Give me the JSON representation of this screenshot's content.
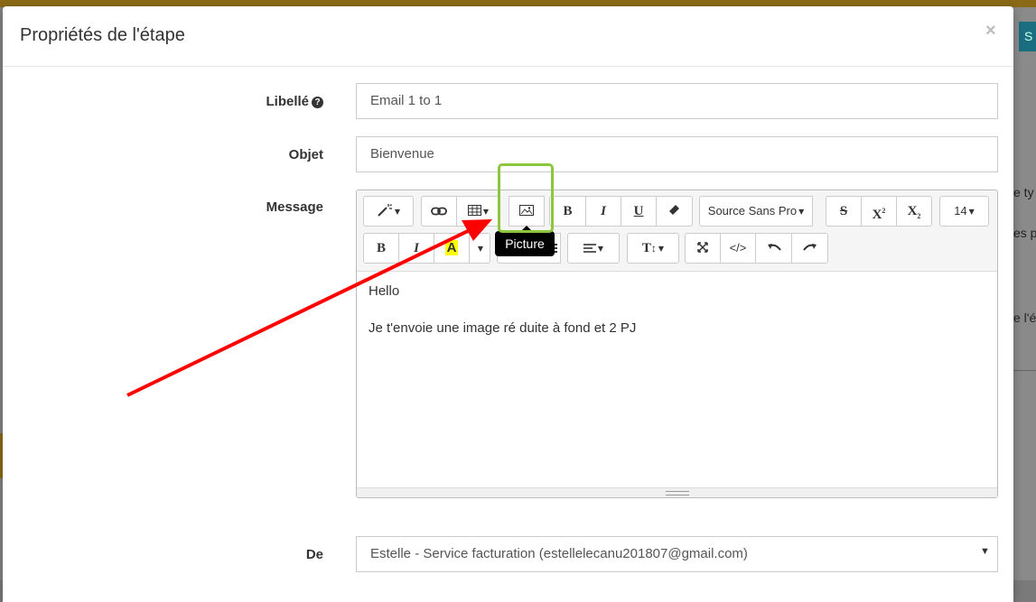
{
  "background": {
    "right_button_label": "S",
    "side_texts": [
      "e ty",
      "es pr",
      "e l'é"
    ]
  },
  "modal": {
    "title": "Propriétés de l'étape",
    "close_label": "×"
  },
  "form": {
    "libelle_label": "Libellé",
    "libelle_value": "Email 1 to 1",
    "objet_label": "Objet",
    "objet_value": "Bienvenue",
    "message_label": "Message",
    "de_label": "De",
    "de_value": "Estelle - Service facturation (estellelecanu201807@gmail.com)"
  },
  "toolbar": {
    "font_name": "Source Sans Pro",
    "font_size": "14",
    "bold": "B",
    "italic": "I",
    "underline": "U",
    "strike": "S",
    "superscript": "X",
    "subscript": "X",
    "highlight": "A",
    "line_height": "T",
    "code": "</>"
  },
  "tooltip": {
    "text": "Picture"
  },
  "editor": {
    "lines": [
      "Hello",
      "Je t'envoie une image ré duite à fond et 2 PJ"
    ]
  },
  "colors": {
    "highlight_border": "#8cc63f",
    "annotation_arrow": "#ff0000",
    "highlight_fill": "#ffff00"
  }
}
